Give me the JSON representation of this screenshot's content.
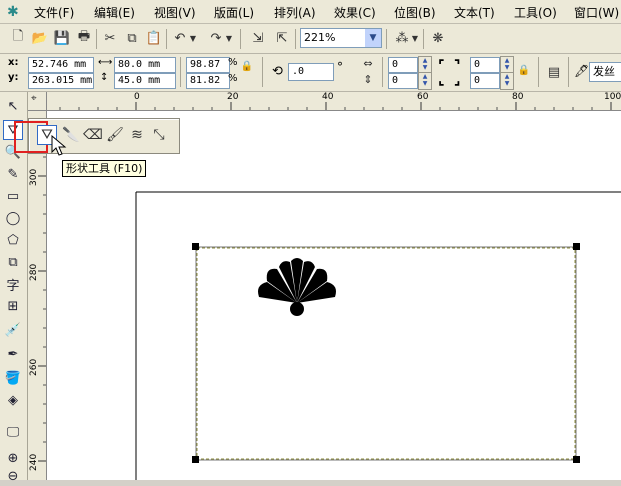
{
  "menubar": {
    "app_icon": "coreldraw-logo-icon",
    "items": [
      "文件(F)",
      "编辑(E)",
      "视图(V)",
      "版面(L)",
      "排列(A)",
      "效果(C)",
      "位图(B)",
      "文本(T)",
      "工具(O)",
      "窗口(W)"
    ]
  },
  "standard_toolbar": {
    "zoom_value": "221%"
  },
  "property_bar": {
    "x_label": "x:",
    "y_label": "y:",
    "x_value": "52.746 mm",
    "y_value": "263.015 mm",
    "width_value": "80.0 mm",
    "height_value": "45.0 mm",
    "scale_x": "98.87",
    "scale_y": "81.82",
    "percent_symbol": "%",
    "rotation_value": ".0",
    "degree_symbol": "°",
    "corner_values": [
      "0",
      "0",
      "0",
      "0"
    ],
    "font_partial": "发丝"
  },
  "rulers": {
    "horizontal_labels": [
      "0",
      "20",
      "40",
      "60",
      "80",
      "100"
    ],
    "vertical_labels": [
      "300",
      "280",
      "260",
      "240"
    ]
  },
  "flyout": {
    "tools": [
      "shape-tool-icon",
      "knife-tool-icon",
      "eraser-tool-icon",
      "smudge-tool-icon",
      "roughen-tool-icon",
      "transform-tool-icon"
    ]
  },
  "tooltip": {
    "text": "形状工具 (F10)"
  },
  "colors": {
    "ui_bg": "#ece9d8",
    "highlight_red": "#e02020",
    "selection_dash": "#8c8c3c"
  }
}
